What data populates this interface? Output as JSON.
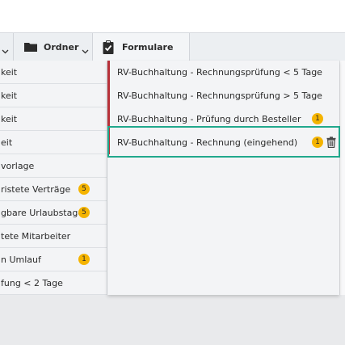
{
  "toolbar": {
    "folder_label": "Ordner",
    "forms_label": "Formulare"
  },
  "left_list": [
    {
      "label": "keit",
      "badge": ""
    },
    {
      "label": "keit",
      "badge": ""
    },
    {
      "label": "keit",
      "badge": ""
    },
    {
      "label": "eit",
      "badge": ""
    },
    {
      "label": "vorlage",
      "badge": ""
    },
    {
      "label": "ristete Verträge",
      "badge": "5"
    },
    {
      "label": "gbare Urlaubstage",
      "badge": "5"
    },
    {
      "label": "tete Mitarbeiter",
      "badge": ""
    },
    {
      "label": "n Umlauf",
      "badge": "1"
    },
    {
      "label": "fung < 2 Tage",
      "badge": ""
    }
  ],
  "forms_menu": [
    {
      "label": "RV-Buchhaltung - Rechnungsprüfung < 5 Tage"
    },
    {
      "label": "RV-Buchhaltung - Rechnungsprüfung > 5 Tage"
    },
    {
      "label": "RV-Buchhaltung - Prüfung durch Besteller",
      "badge": "1"
    },
    {
      "label": "RV-Buchhaltung - Rechnung (eingehend)",
      "badge": "1"
    }
  ],
  "colors": {
    "badge": "#f5b400",
    "item_marker": "#b8323a",
    "highlight": "#21a88c"
  }
}
